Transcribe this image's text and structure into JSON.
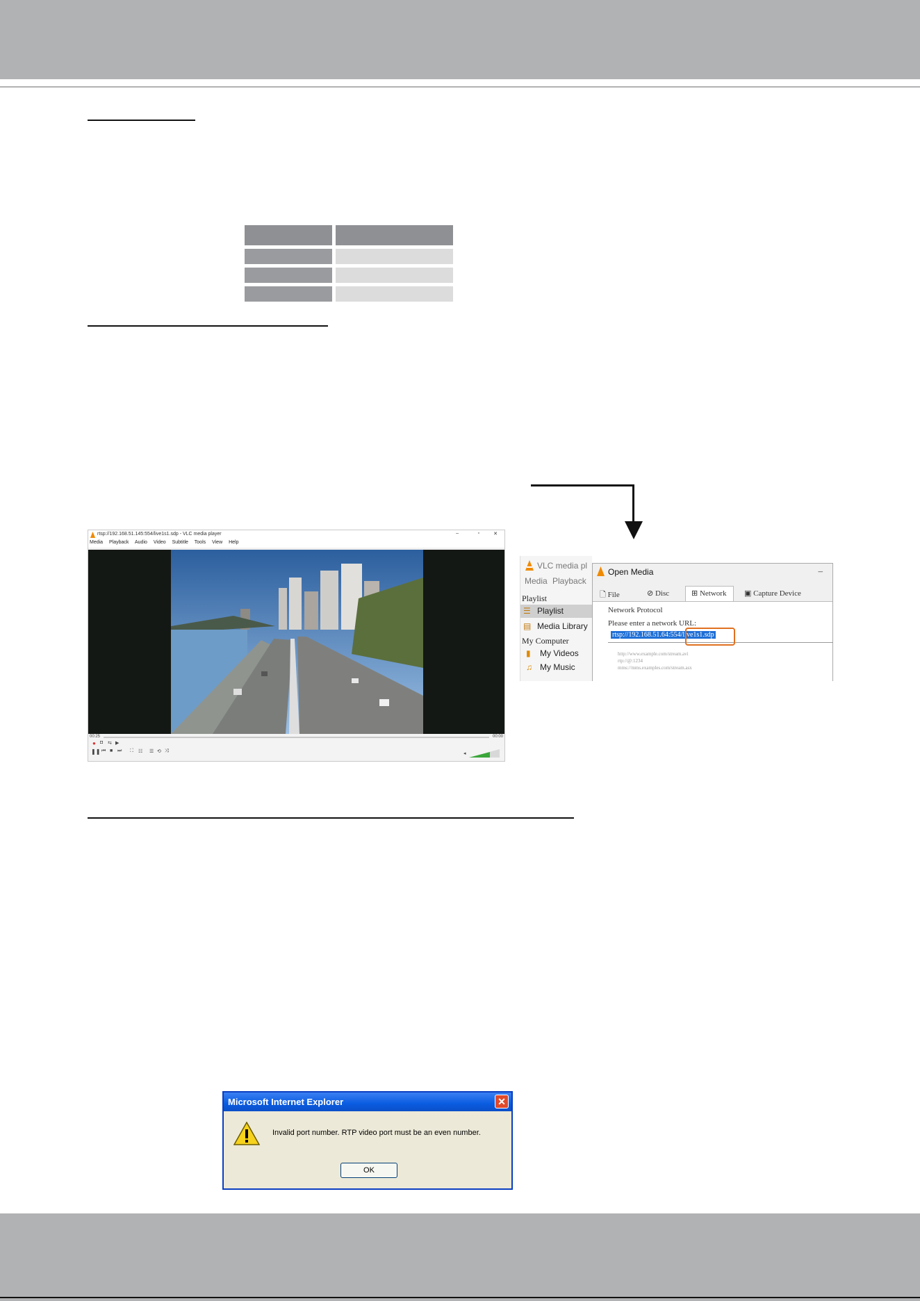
{
  "vlc": {
    "title": "rtsp://192.168.51.145:554/live1s1.sdp - VLC media player",
    "menu": [
      "Media",
      "Playback",
      "Audio",
      "Video",
      "Subtitle",
      "Tools",
      "View",
      "Help"
    ],
    "time_start": "00:25",
    "time_end": "00:00"
  },
  "open_media": {
    "app_title": "VLC media pl",
    "app_menu": [
      "Media",
      "Playback"
    ],
    "sidebar": {
      "playlist_header": "Playlist",
      "playlist_item": "Playlist",
      "media_library": "Media Library",
      "my_computer": "My Computer",
      "my_videos": "My Videos",
      "my_music": "My Music"
    },
    "dialog_title": "Open Media",
    "minimize": "–",
    "tabs": [
      "File",
      "Disc",
      "Network",
      "Capture Device"
    ],
    "section": "Network Protocol",
    "prompt": "Please enter a network URL:",
    "url_value": "rtsp://192.168.51.64:554/live1s1.sdp",
    "examples": [
      "http://www.example.com/stream.avi",
      "rtp://@:1234",
      "mms://mms.examples.com/stream.asx"
    ]
  },
  "ie_dialog": {
    "title": "Microsoft Internet Explorer",
    "message": "Invalid port number. RTP video port must be an even number.",
    "ok_label": "OK",
    "close_label": "✕"
  },
  "colors": {
    "band_gray": "#b1b2b4",
    "highlight_orange": "#e07020",
    "selection_blue": "#1f6fd6"
  }
}
